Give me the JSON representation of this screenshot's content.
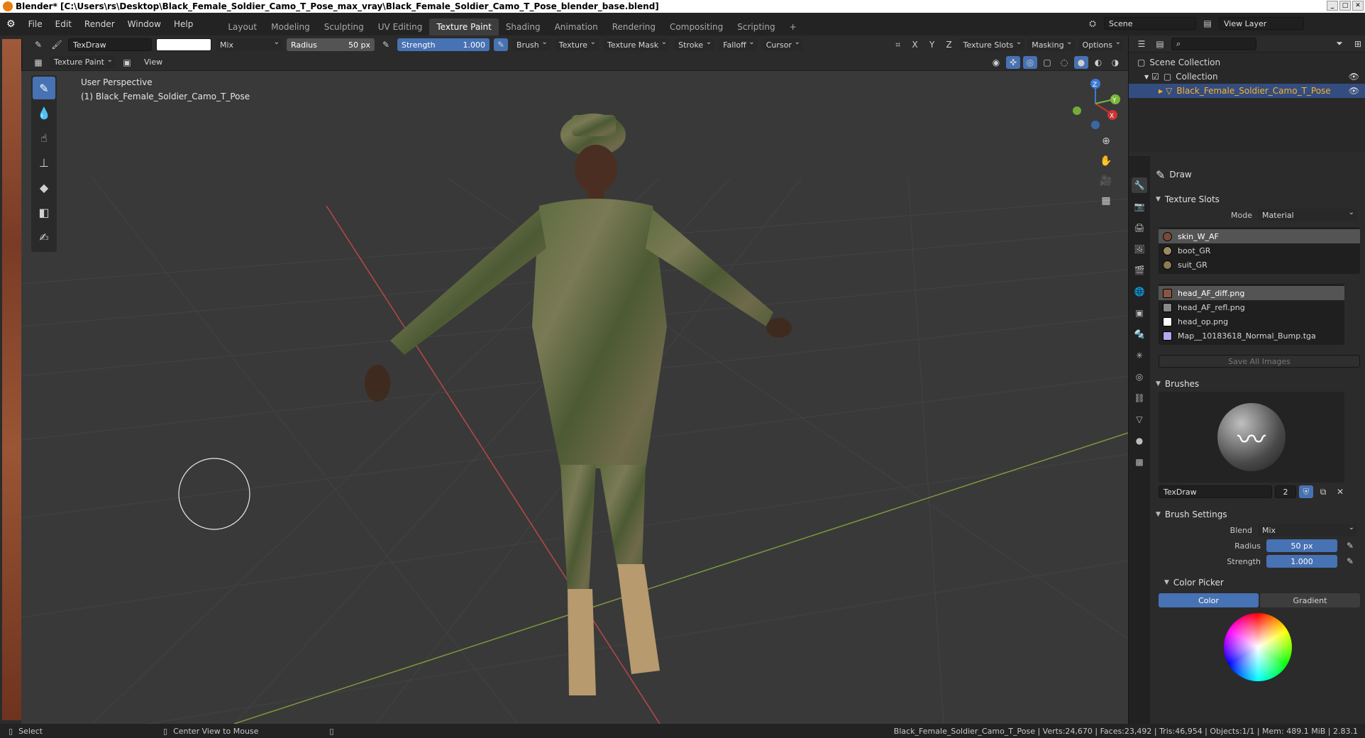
{
  "window": {
    "title": "Blender* [C:\\Users\\rs\\Desktop\\Black_Female_Soldier_Camo_T_Pose_max_vray\\Black_Female_Soldier_Camo_T_Pose_blender_base.blend]"
  },
  "menu": [
    "File",
    "Edit",
    "Render",
    "Window",
    "Help"
  ],
  "workspaces": [
    "Layout",
    "Modeling",
    "Sculpting",
    "UV Editing",
    "Texture Paint",
    "Shading",
    "Animation",
    "Rendering",
    "Compositing",
    "Scripting"
  ],
  "active_workspace": "Texture Paint",
  "scene": {
    "name": "Scene",
    "view_layer": "View Layer"
  },
  "toolheader": {
    "brush_name": "TexDraw",
    "blend": "Mix",
    "radius_label": "Radius",
    "radius_value": "50 px",
    "strength_label": "Strength",
    "strength_value": "1.000",
    "menus": [
      "Brush",
      "Texture",
      "Texture Mask",
      "Stroke",
      "Falloff",
      "Cursor"
    ],
    "axes": [
      "X",
      "Y",
      "Z"
    ],
    "right_menus": [
      "Texture Slots",
      "Masking",
      "Options"
    ]
  },
  "subheader": {
    "mode": "Texture Paint",
    "view": "View"
  },
  "viewport": {
    "perspective": "User Perspective",
    "object": "(1) Black_Female_Soldier_Camo_T_Pose"
  },
  "gizmo": {
    "x": "X",
    "y": "Y",
    "z": "Z"
  },
  "outliner": {
    "scene_collection": "Scene Collection",
    "collection": "Collection",
    "object": "Black_Female_Soldier_Camo_T_Pose"
  },
  "properties": {
    "tool_name": "Draw",
    "texture_slots": {
      "header": "Texture Slots",
      "mode_label": "Mode",
      "mode_value": "Material",
      "materials": [
        "skin_W_AF",
        "boot_GR",
        "suit_GR"
      ],
      "images": [
        "head_AF_diff.png",
        "head_AF_refl.png",
        "head_op.png",
        "Map__10183618_Normal_Bump.tga"
      ],
      "save_all": "Save All Images"
    },
    "brushes": {
      "header": "Brushes",
      "name": "TexDraw",
      "users": "2"
    },
    "brush_settings": {
      "header": "Brush Settings",
      "blend_label": "Blend",
      "blend_value": "Mix",
      "radius_label": "Radius",
      "radius_value": "50 px",
      "strength_label": "Strength",
      "strength_value": "1.000"
    },
    "color_picker": {
      "header": "Color Picker",
      "color_tab": "Color",
      "gradient_tab": "Gradient"
    }
  },
  "statusbar": {
    "select": "Select",
    "center": "Center View to Mouse",
    "stats": "Black_Female_Soldier_Camo_T_Pose | Verts:24,670 | Faces:23,492 | Tris:46,954 | Objects:1/1 | Mem: 489.1 MiB | 2.83.1"
  },
  "colors": {
    "accent": "#4772b3",
    "selection": "#ffaf29",
    "bg": "#393939"
  }
}
